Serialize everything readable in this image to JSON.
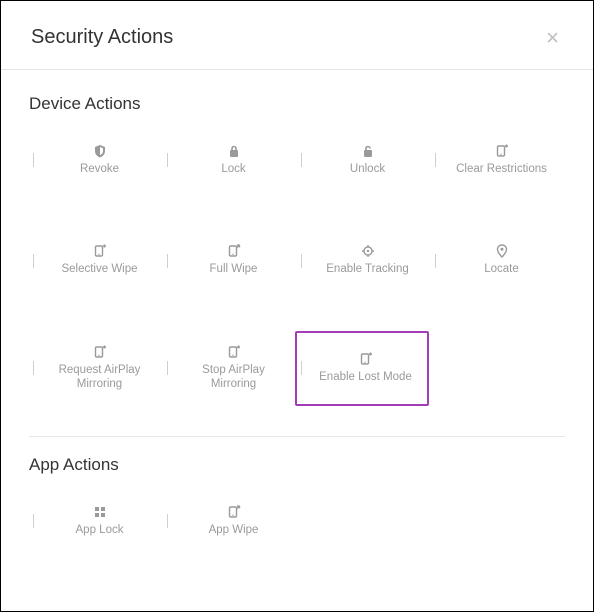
{
  "dialog": {
    "title": "Security Actions"
  },
  "device_section": {
    "title": "Device Actions",
    "actions": [
      {
        "id": "revoke",
        "label": "Revoke",
        "icon": "shield-revoke-icon",
        "highlighted": false
      },
      {
        "id": "lock",
        "label": "Lock",
        "icon": "lock-icon",
        "highlighted": false
      },
      {
        "id": "unlock",
        "label": "Unlock",
        "icon": "unlock-icon",
        "highlighted": false
      },
      {
        "id": "clear-restrictions",
        "label": "Clear Restrictions",
        "icon": "device-plus-icon",
        "highlighted": false
      },
      {
        "id": "selective-wipe",
        "label": "Selective Wipe",
        "icon": "device-plus-icon",
        "highlighted": false
      },
      {
        "id": "full-wipe",
        "label": "Full Wipe",
        "icon": "device-arrow-icon",
        "highlighted": false
      },
      {
        "id": "enable-tracking",
        "label": "Enable Tracking",
        "icon": "target-icon",
        "highlighted": false
      },
      {
        "id": "locate",
        "label": "Locate",
        "icon": "pin-icon",
        "highlighted": false
      },
      {
        "id": "request-airplay",
        "label": "Request AirPlay\nMirroring",
        "icon": "device-plus-icon",
        "highlighted": false
      },
      {
        "id": "stop-airplay",
        "label": "Stop AirPlay\nMirroring",
        "icon": "device-plus-icon",
        "highlighted": false
      },
      {
        "id": "enable-lost-mode",
        "label": "Enable Lost Mode",
        "icon": "device-plus-icon",
        "highlighted": true
      }
    ]
  },
  "app_section": {
    "title": "App Actions",
    "actions": [
      {
        "id": "app-lock",
        "label": "App Lock",
        "icon": "app-grid-icon"
      },
      {
        "id": "app-wipe",
        "label": "App Wipe",
        "icon": "device-arrow-icon"
      }
    ]
  }
}
